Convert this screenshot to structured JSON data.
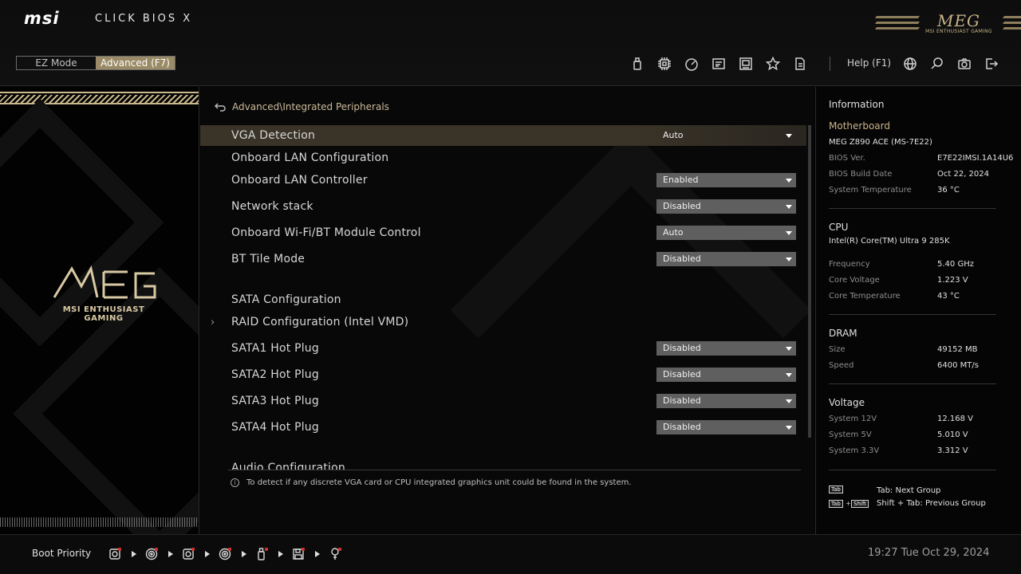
{
  "header": {
    "brand": "msi",
    "product": "CLICK BIOS X",
    "meg_logo": "MEG",
    "meg_tagline": "MSI ENTHUSIAST GAMING",
    "modes": [
      {
        "label": "EZ Mode",
        "active": false
      },
      {
        "label": "Advanced (F7)",
        "active": true
      }
    ],
    "toolbar_icons": [
      "usb-drive-icon",
      "cpu-icon",
      "overclock-gauge-icon",
      "hardware-monitor-icon",
      "memory-icon",
      "favorites-star-icon",
      "bios-flash-icon"
    ],
    "help_label": "Help (F1)",
    "right_icons": [
      "language-globe-icon",
      "search-icon",
      "screenshot-camera-icon",
      "exit-icon"
    ]
  },
  "left_panel": {
    "emblem": "MEG",
    "tagline": "MSI ENTHUSIAST GAMING"
  },
  "center": {
    "breadcrumb": "Advanced\\Integrated Peripherals",
    "settings": [
      {
        "label": "VGA Detection",
        "value": "Auto",
        "selected": true
      },
      {
        "label": "Onboard LAN Configuration",
        "value": null
      },
      {
        "label": "Onboard LAN Controller",
        "value": "Enabled"
      },
      {
        "label": "Network stack",
        "value": "Disabled"
      },
      {
        "label": "Onboard Wi-Fi/BT Module Control",
        "value": "Auto"
      },
      {
        "label": "BT Tile Mode",
        "value": "Disabled"
      },
      {
        "label": "SATA Configuration",
        "value": null
      },
      {
        "label": "RAID Configuration (Intel VMD)",
        "value": null,
        "submenu": true
      },
      {
        "label": "SATA1 Hot Plug",
        "value": "Disabled"
      },
      {
        "label": "SATA2 Hot Plug",
        "value": "Disabled"
      },
      {
        "label": "SATA3 Hot Plug",
        "value": "Disabled"
      },
      {
        "label": "SATA4 Hot Plug",
        "value": "Disabled"
      },
      {
        "label": "Audio Configuration",
        "value": null
      }
    ],
    "hint": "To detect if any discrete VGA card or CPU integrated graphics unit could be found in the system."
  },
  "info": {
    "title": "Information",
    "motherboard": {
      "title": "Motherboard",
      "model": "MEG Z890 ACE (MS-7E22)",
      "bios_ver_label": "BIOS Ver.",
      "bios_ver": "E7E22IMSI.1A14U6",
      "build_date_label": "BIOS Build Date",
      "build_date": "Oct 22, 2024",
      "sys_temp_label": "System Temperature",
      "sys_temp": "36 °C"
    },
    "cpu": {
      "title": "CPU",
      "model": "Intel(R) Core(TM) Ultra 9 285K",
      "freq_label": "Frequency",
      "freq": "5.40 GHz",
      "voltage_label": "Core Voltage",
      "voltage": "1.223 V",
      "temp_label": "Core Temperature",
      "temp": "43 °C"
    },
    "dram": {
      "title": "DRAM",
      "size_label": "Size",
      "size": "49152 MB",
      "speed_label": "Speed",
      "speed": "6400 MT/s"
    },
    "voltage": {
      "title": "Voltage",
      "v12_label": "System 12V",
      "v12": "12.168 V",
      "v5_label": "System 5V",
      "v5": "5.010 V",
      "v33_label": "System 3.3V",
      "v33": "3.312 V"
    },
    "shortcuts": {
      "key_tab": "Tab",
      "key_shift": "Shift",
      "next_group": "Tab: Next Group",
      "prev_group": "Shift + Tab: Previous Group"
    }
  },
  "footer": {
    "boot_label": "Boot Priority",
    "boot_devices": [
      "hdd-icon",
      "optical-disc-icon",
      "hdd-icon",
      "optical-disc-icon",
      "usb-device-icon",
      "floppy-icon",
      "usb-key-icon"
    ],
    "clock": "19:27  Tue Oct 29, 2024"
  }
}
